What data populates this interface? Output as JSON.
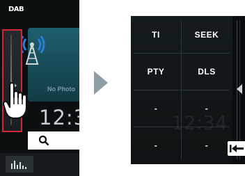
{
  "left_screen": {
    "source_label": "DAB",
    "no_photo": "No Photo",
    "clock": "12:3"
  },
  "panel": {
    "cells": [
      {
        "label": "TI"
      },
      {
        "label": "SEEK"
      },
      {
        "label": "PTY"
      },
      {
        "label": "DLS"
      },
      {
        "label": "-"
      },
      {
        "label": "-"
      },
      {
        "label": "-"
      },
      {
        "label": "-"
      }
    ],
    "ghost_clock": "12:34"
  },
  "colors": {
    "highlight": "#d6243a",
    "art_panel": "#1d5f6c",
    "arrow": "#8e9ea6",
    "panel_bg": "#141b1d"
  },
  "icons": [
    "antenna-icon",
    "search-icon",
    "equalizer-icon",
    "hand-pointer-icon",
    "chevron-left-icon",
    "arrow-right-icon",
    "skip-back-icon"
  ]
}
